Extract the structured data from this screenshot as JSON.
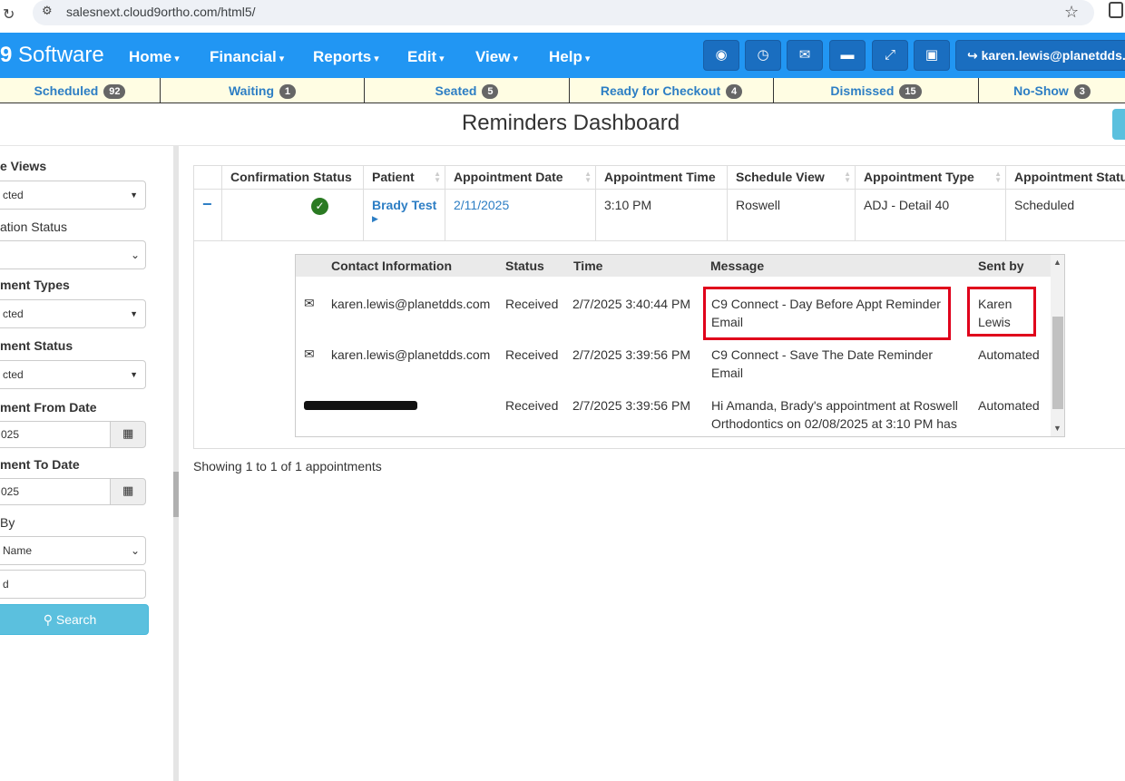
{
  "browser": {
    "url": "salesnext.cloud9ortho.com/html5/"
  },
  "navbar": {
    "brand_prefix": "9",
    "brand_name": "Software",
    "menus": [
      {
        "label": "Home"
      },
      {
        "label": "Financial"
      },
      {
        "label": "Reports"
      },
      {
        "label": "Edit"
      },
      {
        "label": "View"
      },
      {
        "label": "Help"
      }
    ],
    "user": "karen.lewis@planetdds.com",
    "brand_color": "#2196f3"
  },
  "statusbar": [
    {
      "label": "Scheduled",
      "count": "92"
    },
    {
      "label": "Waiting",
      "count": "1"
    },
    {
      "label": "Seated",
      "count": "5"
    },
    {
      "label": "Ready for Checkout",
      "count": "4"
    },
    {
      "label": "Dismissed",
      "count": "15"
    },
    {
      "label": "No-Show",
      "count": "3"
    }
  ],
  "page": {
    "title": "Reminders Dashboard"
  },
  "sidebar": {
    "schedule_views_label": "e Views",
    "schedule_views_value": "cted",
    "confirmation_status_label": "ation Status",
    "confirmation_status_value": "",
    "appointment_types_label": "ment Types",
    "appointment_types_value": "cted",
    "appointment_status_label": "ment Status",
    "appointment_status_value": "cted",
    "from_date_label": "ment From Date",
    "from_date_value": "025",
    "to_date_label": "ment To Date",
    "to_date_value": "025",
    "search_by_label": "By",
    "search_by_value": "Name",
    "search_text_value": "d",
    "search_button": "Search"
  },
  "table": {
    "columns": [
      "Confirmation Status",
      "Patient",
      "Appointment Date",
      "Appointment Time",
      "Schedule View",
      "Appointment Type",
      "Appointment Status"
    ],
    "row": {
      "expand": "−",
      "patient": "Brady Test",
      "date": "2/11/2025",
      "time": "3:10 PM",
      "schedule_view": "Roswell",
      "type": "ADJ - Detail 40",
      "status": "Scheduled"
    }
  },
  "messages": {
    "columns": [
      "Contact Information",
      "Status",
      "Time",
      "Message",
      "Sent by"
    ],
    "rows": [
      {
        "contact": "karen.lewis@planetdds.com",
        "status": "Received",
        "time": "2/7/2025 3:40:44 PM",
        "message_l1": "C9 Connect - Day Before Appt Reminder",
        "message_l2": "Email",
        "sent_l1": "Karen",
        "sent_l2": "Lewis"
      },
      {
        "contact": "karen.lewis@planetdds.com",
        "status": "Received",
        "time": "2/7/2025 3:39:56 PM",
        "message_l1": "C9 Connect - Save The Date Reminder",
        "message_l2": "Email",
        "sent_l1": "Automated",
        "sent_l2": ""
      },
      {
        "contact": "",
        "status": "Received",
        "time": "2/7/2025 3:39:56 PM",
        "message_l1": "Hi Amanda, Brady's appointment at Roswell",
        "message_l2": "Orthodontics on 02/08/2025 at 3:10 PM has",
        "sent_l1": "Automated",
        "sent_l2": ""
      }
    ]
  },
  "footer": {
    "showing": "Showing 1 to 1 of 1 appointments"
  },
  "icons": [
    "reload-icon",
    "site-settings-icon",
    "star-icon",
    "extensions-icon",
    "eye-slash-icon",
    "clock-icon",
    "envelope-icon",
    "chat-icon",
    "expand-icon",
    "lock-icon",
    "sign-out-icon",
    "calendar-icon",
    "search-icon",
    "check-circle-icon",
    "sort-icon"
  ],
  "highlight_color": "#e0001b"
}
